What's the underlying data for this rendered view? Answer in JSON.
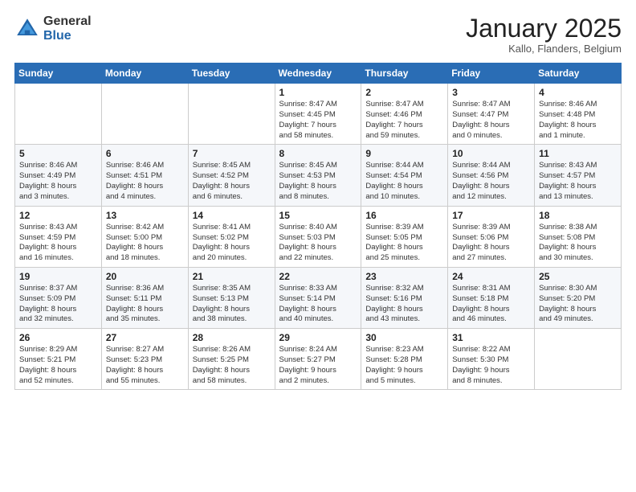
{
  "logo": {
    "general": "General",
    "blue": "Blue"
  },
  "title": "January 2025",
  "location": "Kallo, Flanders, Belgium",
  "days_header": [
    "Sunday",
    "Monday",
    "Tuesday",
    "Wednesday",
    "Thursday",
    "Friday",
    "Saturday"
  ],
  "weeks": [
    [
      {
        "day": "",
        "info": ""
      },
      {
        "day": "",
        "info": ""
      },
      {
        "day": "",
        "info": ""
      },
      {
        "day": "1",
        "info": "Sunrise: 8:47 AM\nSunset: 4:45 PM\nDaylight: 7 hours\nand 58 minutes."
      },
      {
        "day": "2",
        "info": "Sunrise: 8:47 AM\nSunset: 4:46 PM\nDaylight: 7 hours\nand 59 minutes."
      },
      {
        "day": "3",
        "info": "Sunrise: 8:47 AM\nSunset: 4:47 PM\nDaylight: 8 hours\nand 0 minutes."
      },
      {
        "day": "4",
        "info": "Sunrise: 8:46 AM\nSunset: 4:48 PM\nDaylight: 8 hours\nand 1 minute."
      }
    ],
    [
      {
        "day": "5",
        "info": "Sunrise: 8:46 AM\nSunset: 4:49 PM\nDaylight: 8 hours\nand 3 minutes."
      },
      {
        "day": "6",
        "info": "Sunrise: 8:46 AM\nSunset: 4:51 PM\nDaylight: 8 hours\nand 4 minutes."
      },
      {
        "day": "7",
        "info": "Sunrise: 8:45 AM\nSunset: 4:52 PM\nDaylight: 8 hours\nand 6 minutes."
      },
      {
        "day": "8",
        "info": "Sunrise: 8:45 AM\nSunset: 4:53 PM\nDaylight: 8 hours\nand 8 minutes."
      },
      {
        "day": "9",
        "info": "Sunrise: 8:44 AM\nSunset: 4:54 PM\nDaylight: 8 hours\nand 10 minutes."
      },
      {
        "day": "10",
        "info": "Sunrise: 8:44 AM\nSunset: 4:56 PM\nDaylight: 8 hours\nand 12 minutes."
      },
      {
        "day": "11",
        "info": "Sunrise: 8:43 AM\nSunset: 4:57 PM\nDaylight: 8 hours\nand 13 minutes."
      }
    ],
    [
      {
        "day": "12",
        "info": "Sunrise: 8:43 AM\nSunset: 4:59 PM\nDaylight: 8 hours\nand 16 minutes."
      },
      {
        "day": "13",
        "info": "Sunrise: 8:42 AM\nSunset: 5:00 PM\nDaylight: 8 hours\nand 18 minutes."
      },
      {
        "day": "14",
        "info": "Sunrise: 8:41 AM\nSunset: 5:02 PM\nDaylight: 8 hours\nand 20 minutes."
      },
      {
        "day": "15",
        "info": "Sunrise: 8:40 AM\nSunset: 5:03 PM\nDaylight: 8 hours\nand 22 minutes."
      },
      {
        "day": "16",
        "info": "Sunrise: 8:39 AM\nSunset: 5:05 PM\nDaylight: 8 hours\nand 25 minutes."
      },
      {
        "day": "17",
        "info": "Sunrise: 8:39 AM\nSunset: 5:06 PM\nDaylight: 8 hours\nand 27 minutes."
      },
      {
        "day": "18",
        "info": "Sunrise: 8:38 AM\nSunset: 5:08 PM\nDaylight: 8 hours\nand 30 minutes."
      }
    ],
    [
      {
        "day": "19",
        "info": "Sunrise: 8:37 AM\nSunset: 5:09 PM\nDaylight: 8 hours\nand 32 minutes."
      },
      {
        "day": "20",
        "info": "Sunrise: 8:36 AM\nSunset: 5:11 PM\nDaylight: 8 hours\nand 35 minutes."
      },
      {
        "day": "21",
        "info": "Sunrise: 8:35 AM\nSunset: 5:13 PM\nDaylight: 8 hours\nand 38 minutes."
      },
      {
        "day": "22",
        "info": "Sunrise: 8:33 AM\nSunset: 5:14 PM\nDaylight: 8 hours\nand 40 minutes."
      },
      {
        "day": "23",
        "info": "Sunrise: 8:32 AM\nSunset: 5:16 PM\nDaylight: 8 hours\nand 43 minutes."
      },
      {
        "day": "24",
        "info": "Sunrise: 8:31 AM\nSunset: 5:18 PM\nDaylight: 8 hours\nand 46 minutes."
      },
      {
        "day": "25",
        "info": "Sunrise: 8:30 AM\nSunset: 5:20 PM\nDaylight: 8 hours\nand 49 minutes."
      }
    ],
    [
      {
        "day": "26",
        "info": "Sunrise: 8:29 AM\nSunset: 5:21 PM\nDaylight: 8 hours\nand 52 minutes."
      },
      {
        "day": "27",
        "info": "Sunrise: 8:27 AM\nSunset: 5:23 PM\nDaylight: 8 hours\nand 55 minutes."
      },
      {
        "day": "28",
        "info": "Sunrise: 8:26 AM\nSunset: 5:25 PM\nDaylight: 8 hours\nand 58 minutes."
      },
      {
        "day": "29",
        "info": "Sunrise: 8:24 AM\nSunset: 5:27 PM\nDaylight: 9 hours\nand 2 minutes."
      },
      {
        "day": "30",
        "info": "Sunrise: 8:23 AM\nSunset: 5:28 PM\nDaylight: 9 hours\nand 5 minutes."
      },
      {
        "day": "31",
        "info": "Sunrise: 8:22 AM\nSunset: 5:30 PM\nDaylight: 9 hours\nand 8 minutes."
      },
      {
        "day": "",
        "info": ""
      }
    ]
  ]
}
